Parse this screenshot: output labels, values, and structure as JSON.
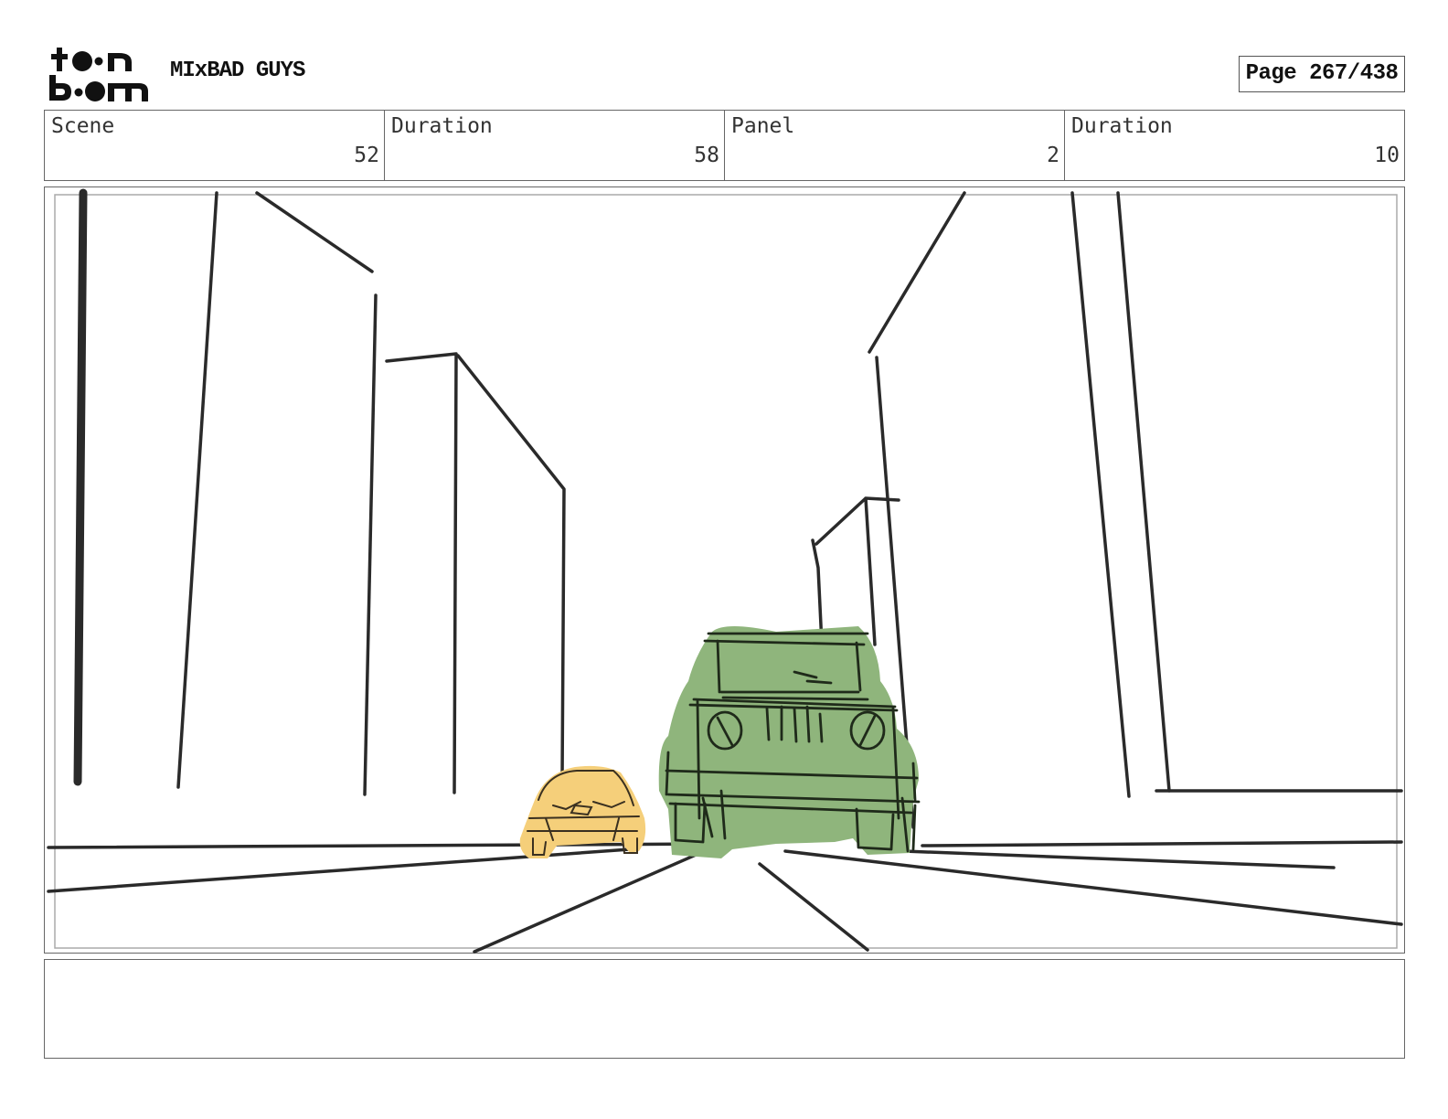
{
  "header": {
    "project_title": "MIxBAD GUYS",
    "page_label": "Page 267/438"
  },
  "info": {
    "scene_label": "Scene",
    "scene_value": "52",
    "scene_duration_label": "Duration",
    "scene_duration_value": "58",
    "panel_label": "Panel",
    "panel_value": "2",
    "panel_duration_label": "Duration",
    "panel_duration_value": "10"
  },
  "notes": {
    "text": ""
  },
  "colors": {
    "jeep_green": "#8fb57c",
    "taxi_yellow": "#f5cf7a",
    "line_dark": "#2a2a2a"
  }
}
